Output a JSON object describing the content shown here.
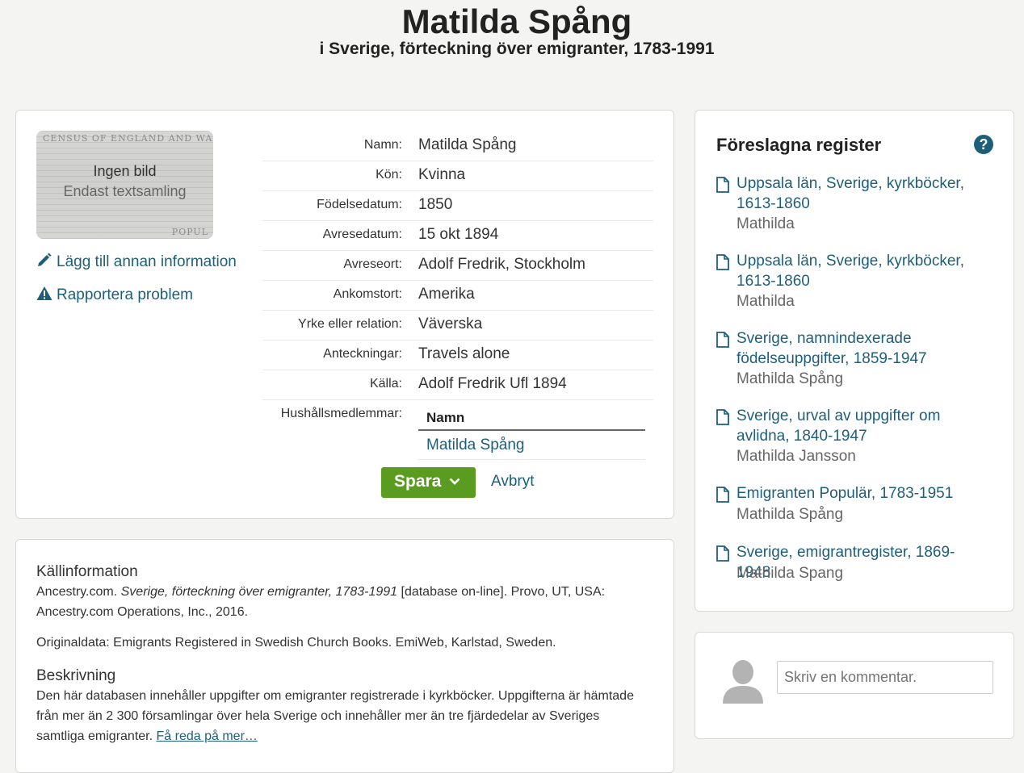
{
  "header": {
    "title": "Matilda Spång",
    "subtitle": "i Sverige, förteckning över emigranter, 1783-1991"
  },
  "record": {
    "image": {
      "background_text": "CENSUS OF ENGLAND AND WALES.",
      "background_text2": "POPUL",
      "line1": "Ingen bild",
      "line2": "Endast textsamling"
    },
    "add_info_label": "Lägg till annan information",
    "report_label": "Rapportera problem",
    "fields": [
      {
        "label": "Namn:",
        "value": "Matilda Spång"
      },
      {
        "label": "Kön:",
        "value": "Kvinna"
      },
      {
        "label": "Födelsedatum:",
        "value": "1850"
      },
      {
        "label": "Avresedatum:",
        "value": "15 okt 1894"
      },
      {
        "label": "Avreseort:",
        "value": "Adolf Fredrik, Stockholm"
      },
      {
        "label": "Ankomstort:",
        "value": "Amerika"
      },
      {
        "label": "Yrke eller relation:",
        "value": "Väverska"
      },
      {
        "label": "Anteckningar:",
        "value": "Travels alone"
      },
      {
        "label": "Källa:",
        "value": "Adolf Fredrik Ufl 1894"
      }
    ],
    "household": {
      "label": "Hushållsmedlemmar:",
      "column": "Namn",
      "members": [
        "Matilda Spång"
      ]
    },
    "save_label": "Spara",
    "cancel_label": "Avbryt"
  },
  "source": {
    "heading": "Källinformation",
    "citation_prefix": "Ancestry.com. ",
    "citation_title": "Sverige, förteckning över emigranter, 1783-1991",
    "citation_suffix": " [database on-line]. Provo, UT, USA: Ancestry.com Operations, Inc., 2016.",
    "original": "Originaldata: Emigrants Registered in Swedish Church Books. EmiWeb, Karlstad, Sweden.",
    "desc_heading": "Beskrivning",
    "desc_text": "Den här databasen innehåller uppgifter om emigranter registrerade i kyrkböcker. Uppgifterna är hämtade från mer än 2 300 församlingar över hela Sverige och innehåller mer än tre fjärdedelar av Sveriges samtliga emigranter. ",
    "learn_more": "Få reda på mer…"
  },
  "suggested": {
    "title": "Föreslagna register",
    "help": "?",
    "items": [
      {
        "title": "Uppsala län, Sverige, kyrkböcker, 1613-1860",
        "name": "Mathilda"
      },
      {
        "title": "Uppsala län, Sverige, kyrkböcker, 1613-1860",
        "name": "Mathilda"
      },
      {
        "title": "Sverige, namnindexerade födelseuppgifter, 1859-1947",
        "name": "Mathilda Spång"
      },
      {
        "title": "Sverige, urval av uppgifter om avlidna, 1840-1947",
        "name": "Mathilda Jansson"
      },
      {
        "title": "Emigranten Populär, 1783-1951",
        "name": "Mathilda Spång"
      },
      {
        "title": "Sverige, emigrantregister, 1869-1948",
        "name": "Mathilda Spang"
      }
    ]
  },
  "comment": {
    "placeholder": "Skriv en kommentar."
  },
  "colors": {
    "link": "#1d5f7a",
    "save_button": "#5a9c1f",
    "background": "#f4f4f2"
  }
}
